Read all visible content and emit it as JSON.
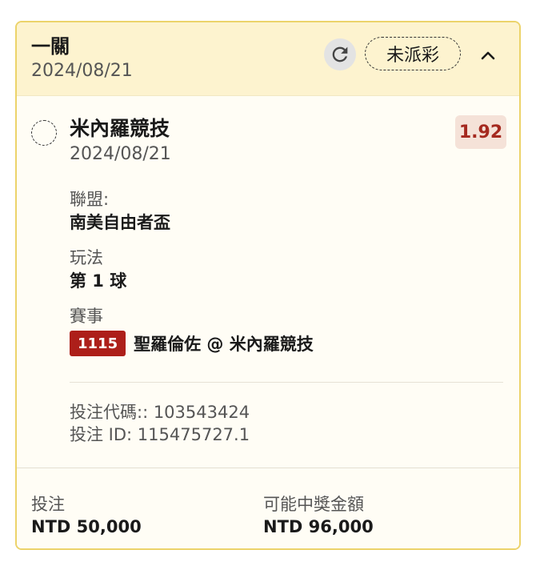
{
  "header": {
    "bet_type": "一關",
    "date": "2024/08/21",
    "status": "未派彩"
  },
  "selection": {
    "team": "米內羅競技",
    "date": "2024/08/21",
    "odds": "1.92",
    "league_label": "聯盟:",
    "league_value": "南美自由者盃",
    "market_label": "玩法",
    "market_value": "第 1 球",
    "event_label": "賽事",
    "event_id": "1115",
    "event_name": "聖羅倫佐 @ 米內羅競技"
  },
  "meta": {
    "bet_code": "投注代碼:: 103543424",
    "bet_id": "投注 ID: 115475727.1"
  },
  "footer": {
    "stake_label": "投注",
    "stake_value": "NTD 50,000",
    "payout_label": "可能中獎金額",
    "payout_value": "NTD 96,000"
  },
  "icons": {
    "refresh": "refresh-icon",
    "collapse": "chevron-up-icon"
  },
  "colors": {
    "border": "#ecd36a",
    "header_bg": "#fdf3cf",
    "odds_text": "#a5291f",
    "event_badge": "#ad1f1a"
  }
}
